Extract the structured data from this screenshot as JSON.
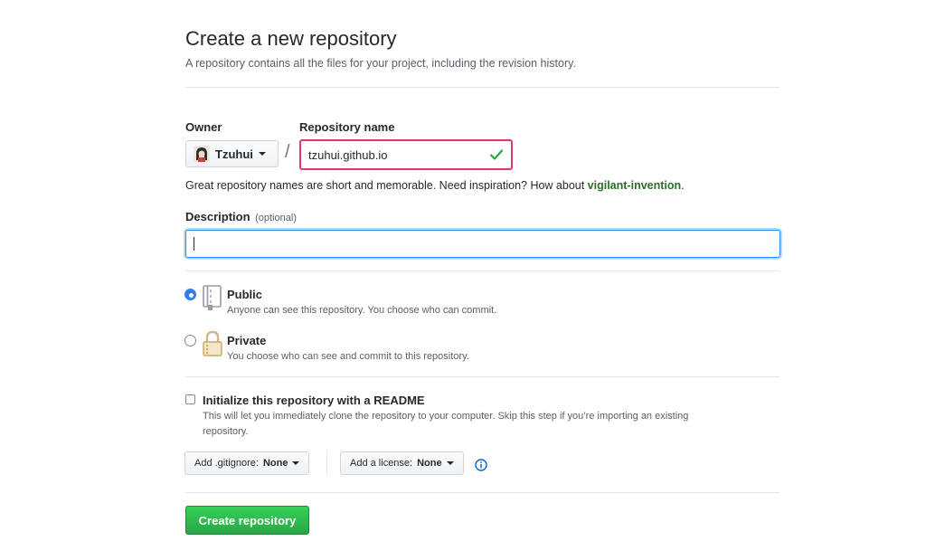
{
  "header": {
    "title": "Create a new repository",
    "subtitle": "A repository contains all the files for your project, including the revision history."
  },
  "owner": {
    "label": "Owner",
    "value": "Tzuhui",
    "icon": "owner-avatar-icon"
  },
  "separator": "/",
  "repo_name": {
    "label": "Repository name",
    "value": "tzuhui.github.io",
    "valid_icon": "check-icon",
    "border_color": "#e4376b"
  },
  "name_hint": {
    "text": "Great repository names are short and memorable. Need inspiration? How about ",
    "suggestion": "vigilant-invention",
    "end": "."
  },
  "description": {
    "label": "Description",
    "optional": "(optional)",
    "value": ""
  },
  "visibility": {
    "selected": "public",
    "public": {
      "title": "Public",
      "desc": "Anyone can see this repository. You choose who can commit.",
      "icon": "repo-book-icon"
    },
    "private": {
      "title": "Private",
      "desc": "You choose who can see and commit to this repository.",
      "icon": "lock-icon"
    }
  },
  "readme": {
    "checked": false,
    "title": "Initialize this repository with a README",
    "desc_line1": "This will let you immediately clone the repository to your computer. Skip this step if you’re importing an existing",
    "desc_line2": "repository."
  },
  "gitignore": {
    "label": "Add .gitignore:",
    "value": "None"
  },
  "license": {
    "label": "Add a license:",
    "value": "None",
    "info_icon": "info-icon"
  },
  "submit": {
    "label": "Create repository",
    "color": "#28a745"
  }
}
